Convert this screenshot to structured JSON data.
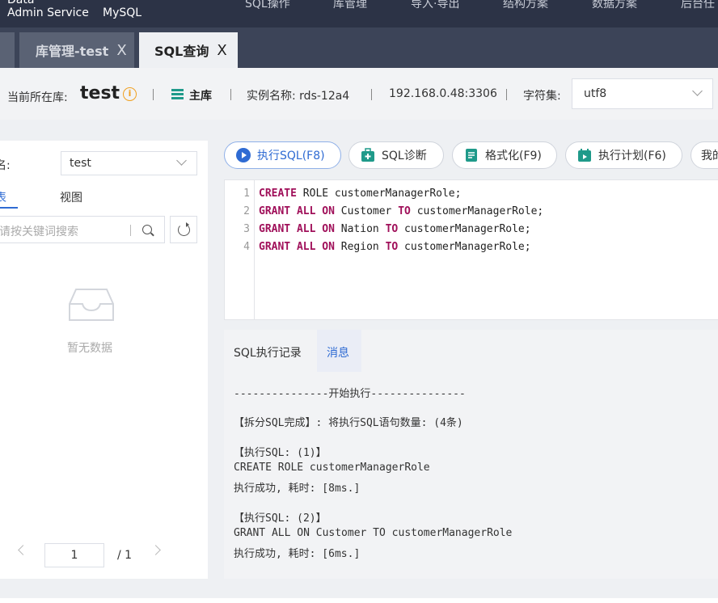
{
  "brand": {
    "line1": "Data",
    "line2": "Admin Service",
    "product": "MySQL"
  },
  "nav": [
    "SQL操作",
    "库管理",
    "导入·导出",
    "结构方案",
    "数据方案",
    "后台任"
  ],
  "tabs": [
    {
      "label": "库管理-test",
      "close": "X",
      "active": false
    },
    {
      "label": "SQL查询",
      "close": "X",
      "active": true
    }
  ],
  "info": {
    "current_db_label": "当前所在库:",
    "db_name": "test",
    "info_icon": "i",
    "role": "主库",
    "instance": "实例名称: rds-12a4",
    "address": "192.168.0.48:3306",
    "charset_label": "字符集:",
    "charset_value": "utf8"
  },
  "left": {
    "db_label": "名:",
    "db_value": "test",
    "tab_table": "表",
    "tab_view": "视图",
    "search_placeholder": "请按关键词搜索",
    "empty_text": "暂无数据",
    "pager": {
      "page": "1",
      "total": "/ 1"
    }
  },
  "toolbar": [
    {
      "name": "execute-sql-button",
      "label": "执行SQL(F8)",
      "icon": "play-icon"
    },
    {
      "name": "sql-diagnose-button",
      "label": "SQL诊断",
      "icon": "medkit-icon"
    },
    {
      "name": "format-button",
      "label": "格式化(F9)",
      "icon": "document-icon"
    },
    {
      "name": "execution-plan-button",
      "label": "执行计划(F6)",
      "icon": "calendar-icon"
    },
    {
      "name": "my-button",
      "label": "我的",
      "icon": ""
    }
  ],
  "editor": {
    "lines": [
      {
        "n": "1",
        "parts": [
          [
            "kw",
            "CREATE"
          ],
          [
            "t",
            " ROLE customerManagerRole;"
          ]
        ]
      },
      {
        "n": "2",
        "parts": [
          [
            "kw",
            "GRANT"
          ],
          [
            "t",
            " "
          ],
          [
            "kw",
            "ALL"
          ],
          [
            "t",
            " "
          ],
          [
            "kw",
            "ON"
          ],
          [
            "t",
            " Customer "
          ],
          [
            "kw",
            "TO"
          ],
          [
            "t",
            " customerManagerRole;"
          ]
        ]
      },
      {
        "n": "3",
        "parts": [
          [
            "kw",
            "GRANT"
          ],
          [
            "t",
            " "
          ],
          [
            "kw",
            "ALL"
          ],
          [
            "t",
            " "
          ],
          [
            "kw",
            "ON"
          ],
          [
            "t",
            " Nation "
          ],
          [
            "kw",
            "TO"
          ],
          [
            "t",
            " customerManagerRole;"
          ]
        ]
      },
      {
        "n": "4",
        "parts": [
          [
            "kw",
            "GRANT"
          ],
          [
            "t",
            " "
          ],
          [
            "kw",
            "ALL"
          ],
          [
            "t",
            " "
          ],
          [
            "kw",
            "ON"
          ],
          [
            "t",
            " Region "
          ],
          [
            "kw",
            "TO"
          ],
          [
            "t",
            " customerManagerRole;"
          ]
        ]
      }
    ]
  },
  "results": {
    "tab_history": "SQL执行记录",
    "tab_messages": "消息",
    "messages": [
      "---------------开始执行---------------",
      "【拆分SQL完成】: 将执行SQL语句数量: (4条)",
      "【执行SQL: (1)】",
      "CREATE ROLE customerManagerRole",
      "执行成功, 耗时: [8ms.]",
      "【执行SQL: (2)】",
      "GRANT ALL ON Customer TO customerManagerRole",
      "执行成功, 耗时: [6ms.]"
    ]
  },
  "colors": {
    "accent": "#2f6bd3",
    "nav_bg": "#2c3346",
    "keyword": "#a0105a",
    "primary_db": "#1f9a8a"
  }
}
